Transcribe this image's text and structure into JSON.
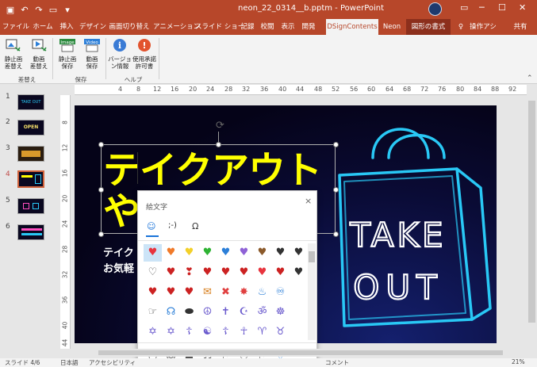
{
  "window": {
    "title": "neon_22_0314__b.pptm  -  PowerPoint",
    "user_initial": ""
  },
  "quick_access": [
    "save-icon",
    "undo-icon",
    "redo-icon",
    "start-from-beginning-icon",
    "customize-icon"
  ],
  "tabs": [
    "ファイル",
    "ホーム",
    "挿入",
    "デザイン",
    "画面切り替え",
    "アニメーション",
    "スライド ショー",
    "記録",
    "校閲",
    "表示",
    "開発",
    "DSignContents",
    "Neon",
    "図形の書式",
    "操作アシ",
    "共有"
  ],
  "ribbon": {
    "groups": [
      {
        "label": "差替え",
        "buttons": [
          {
            "label": "静止画\n差替え",
            "icon": "still-image-icon"
          },
          {
            "label": "動画\n差替え",
            "icon": "video-icon"
          }
        ]
      },
      {
        "label": "保存",
        "buttons": [
          {
            "label": "静止画\n保存",
            "icon": "image-save-icon",
            "badge": "Image"
          },
          {
            "label": "動画\n保存",
            "icon": "video-save-icon",
            "badge": "Video"
          }
        ]
      },
      {
        "label": "ヘルプ",
        "buttons": [
          {
            "label": "バージョ\nン情報",
            "icon": "info-icon"
          },
          {
            "label": "使用承諾\n許可書",
            "icon": "warning-icon"
          }
        ]
      }
    ]
  },
  "thumbnails": [
    {
      "num": "1",
      "label": "TAKE OUT",
      "selected": false
    },
    {
      "num": "2",
      "label": "OPEN",
      "selected": false
    },
    {
      "num": "3",
      "label": "",
      "selected": false
    },
    {
      "num": "4",
      "label": "",
      "selected": true
    },
    {
      "num": "5",
      "label": "",
      "selected": false
    },
    {
      "num": "6",
      "label": "",
      "selected": false
    }
  ],
  "ruler": {
    "horizontal": [
      "4",
      "8",
      "12",
      "16",
      "20",
      "24",
      "28",
      "32",
      "36",
      "40",
      "44",
      "48",
      "52",
      "56",
      "60",
      "64",
      "68",
      "72",
      "76",
      "80",
      "84",
      "88",
      "92"
    ],
    "vertical": [
      "8",
      "12",
      "16",
      "20",
      "24",
      "28",
      "32",
      "36",
      "40",
      "44"
    ]
  },
  "slide": {
    "title_line1": "テイクアウト",
    "title_line2": "や",
    "subtitle_line1": "テイク",
    "subtitle_line2": "お気軽",
    "sign_line1": "TAKE",
    "sign_line2": "OUT",
    "neon_color": "#29c8f5",
    "title_color": "#ffff00"
  },
  "emoji_panel": {
    "title": "絵文字",
    "close": "×",
    "tabs": [
      "☺",
      ";-)",
      "Ω"
    ],
    "rows": [
      [
        "♥",
        "♥",
        "♥",
        "♥",
        "♥",
        "♥",
        "♥",
        "♥",
        "♥"
      ],
      [
        "♡",
        "♥",
        "❣",
        "♥",
        "♥",
        "♥",
        "♥",
        "♥",
        "♥"
      ],
      [
        "♥",
        "♥",
        "♥",
        "✉",
        "✖",
        "✸",
        "♨",
        "♾",
        ""
      ],
      [
        "☞",
        "☊",
        "⬬",
        "☮",
        "✝",
        "☪",
        "ॐ",
        "☸",
        ""
      ],
      [
        "✡",
        "✡",
        "☦",
        "☯",
        "☦",
        "☥",
        "♈",
        "♉",
        ""
      ],
      [
        "◷",
        "☺",
        "☗",
        "♬",
        "⚐",
        "⚇",
        "⚑",
        "♡",
        ""
      ]
    ],
    "row_colors": [
      [
        "#e8343e",
        "#f07a2a",
        "#f3d02a",
        "#2fb334",
        "#2c7fd8",
        "#8f62d6",
        "#8b5a2b",
        "#333333",
        ""
      ],
      [
        "#555555",
        "#cc2222",
        "#cc2222",
        "#cc2222",
        "#cc2222",
        "#cc2222",
        "#e8343e",
        "#cc2222",
        ""
      ],
      [
        "#cc2222",
        "#cc2222",
        "#cc2222",
        "#d77e1c",
        "#e04040",
        "#e04040",
        "#2c7fd8",
        "#2c7fd8",
        ""
      ],
      [
        "#555555",
        "#2c7fd8",
        "#333333",
        "#6a5acd",
        "#6a5acd",
        "#6a5acd",
        "#6a5acd",
        "#6a5acd",
        ""
      ],
      [
        "#6a5acd",
        "#6a5acd",
        "#6a5acd",
        "#6a5acd",
        "#6a5acd",
        "#6a5acd",
        "#6a5acd",
        "#6a5acd",
        ""
      ],
      [
        "#555555",
        "#555555",
        "#555555",
        "#555555",
        "#555555",
        "#555555",
        "#555555",
        "#2c7fd8",
        ""
      ]
    ]
  },
  "status": {
    "slide_info": "スライド 4/6",
    "language": "日本語",
    "accessibility": "アクセシビリティ",
    "comments": "コメント",
    "zoom": "21%"
  }
}
